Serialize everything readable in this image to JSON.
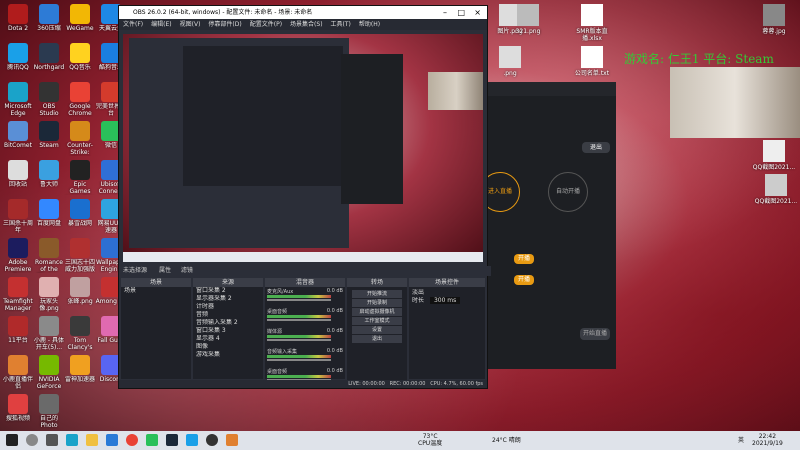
{
  "desktop": {
    "left_icons": [
      {
        "label": "Dota 2",
        "color": "#b01c1c"
      },
      {
        "label": "360压缩",
        "color": "#2d7bd6"
      },
      {
        "label": "WeGame",
        "color": "#f2b705"
      },
      {
        "label": "天翼云盘",
        "color": "#1e88e5"
      },
      {
        "label": "腾讯QQ",
        "color": "#1aa0e8"
      },
      {
        "label": "Northgard",
        "color": "#2b3a50"
      },
      {
        "label": "QQ音乐",
        "color": "#ffd21f"
      },
      {
        "label": "酷狗音乐",
        "color": "#1a7ee0"
      },
      {
        "label": "Microsoft Edge",
        "color": "#1aa3c9"
      },
      {
        "label": "OBS Studio",
        "color": "#333333"
      },
      {
        "label": "Google Chrome",
        "color": "#e94235"
      },
      {
        "label": "完美世界平台",
        "color": "#d43b2c"
      },
      {
        "label": "BitComet",
        "color": "#5a8fd6"
      },
      {
        "label": "Steam",
        "color": "#1b2838"
      },
      {
        "label": "Counter-Strike: Global Off...",
        "color": "#d58a1a"
      },
      {
        "label": "微信",
        "color": "#2ac05a"
      },
      {
        "label": "回收站",
        "color": "#dddddd"
      },
      {
        "label": "鲁大师",
        "color": "#3aa0e0"
      },
      {
        "label": "Epic Games Launcher",
        "color": "#222222"
      },
      {
        "label": "Ubisoft Connect",
        "color": "#2f6fd6"
      },
      {
        "label": "三国杀十周年",
        "color": "#a52a2a"
      },
      {
        "label": "百度网盘",
        "color": "#3388ff"
      },
      {
        "label": "暴雪战网",
        "color": "#1a6fcf"
      },
      {
        "label": "网易UU加速器",
        "color": "#2ea4e0"
      },
      {
        "label": "Adobe Premiere Pro",
        "color": "#1c1c5e"
      },
      {
        "label": "Romance of the Three ...",
        "color": "#8a5a2a"
      },
      {
        "label": "三国志十四威力加强版",
        "color": "#b03030"
      },
      {
        "label": "Wallpaper Engine",
        "color": "#2d6fd2"
      },
      {
        "label": "Teamfight Manager",
        "color": "#c43030"
      },
      {
        "label": "玩家头像.png",
        "color": "#e0b0b0"
      },
      {
        "label": "张峰.png",
        "color": "#c0a0a0"
      },
      {
        "label": "Among Us",
        "color": "#c43030"
      },
      {
        "label": "11平台",
        "color": "#b02a2a"
      },
      {
        "label": "小鹿 - 具体开车(5)...",
        "color": "#8a8a8a"
      },
      {
        "label": "Tom Clancy's R...",
        "color": "#3a3a3a"
      },
      {
        "label": "Fall Guys",
        "color": "#e06ab0"
      },
      {
        "label": "小鹿直播伴侣",
        "color": "#e08030"
      },
      {
        "label": "NVIDIA GeForce Exper...",
        "color": "#76b900"
      },
      {
        "label": "雷神加速器",
        "color": "#f0a020"
      },
      {
        "label": "Discord",
        "color": "#5865f2"
      },
      {
        "label": "搜狐视频",
        "color": "#e04040"
      },
      {
        "label": "自己的Photo",
        "color": "#6a6a6a"
      }
    ],
    "right_icons": [
      {
        "label": "图片.png",
        "color": "#ddd"
      },
      {
        "label": "321.png",
        "color": "#bbb"
      },
      {
        "label": "SMR版本直播.xlsx",
        "color": "#ffffff"
      },
      {
        "label": "蓉蓉.jpg",
        "color": "#888"
      },
      {
        "label": "QQ截图2021...",
        "color": "#eee"
      },
      {
        "label": "QQ截图2021...",
        "color": "#ccc"
      },
      {
        "label": ".png",
        "color": "#ddd"
      },
      {
        "label": "公司名单.txt",
        "color": "#fff"
      }
    ]
  },
  "overlay": {
    "text": "游戏名: 仁王1 平台: Steam"
  },
  "obs": {
    "title": "OBS 26.0.2 (64-bit, windows) - 配置文件: 未命名 - 场景: 未命名",
    "menu": [
      "文件(F)",
      "编辑(E)",
      "视图(V)",
      "停靠部件(D)",
      "配置文件(P)",
      "场景集合(S)",
      "工具(T)",
      "帮助(H)"
    ],
    "scene_label": "未选择源",
    "tabs": {
      "properties": "属性",
      "filters": "滤镜"
    },
    "docks": [
      "场景",
      "来源",
      "混音器",
      "转场",
      "场景控件"
    ],
    "scenes": [
      "场景"
    ],
    "sources": [
      "窗口采集 2",
      "显示器采集 2",
      "计时器",
      "音频",
      "音频输入采集 2",
      "窗口采集 3",
      "显示器 4",
      "图像",
      "游戏采集"
    ],
    "mixer": [
      {
        "name": "麦克风/Aux",
        "db": "0.0 dB"
      },
      {
        "name": "桌面音频",
        "db": "0.0 dB"
      },
      {
        "name": "媒体源",
        "db": "0.0 dB"
      },
      {
        "name": "音频输入采集",
        "db": "0.0 dB"
      },
      {
        "name": "桌面音频",
        "db": "0.0 dB"
      }
    ],
    "transition": {
      "type": "淡出",
      "duration_label": "时长",
      "duration": "300 ms"
    },
    "controls": [
      "开始推流",
      "开始录制",
      "启动虚拟摄像机",
      "工作室模式",
      "设置",
      "退出"
    ],
    "status": {
      "live": "LIVE: 00:00:00",
      "rec": "REC: 00:00:00",
      "cpu": "CPU: 4.7%, 60.00 fps"
    }
  },
  "live_app": {
    "top_button": "退出",
    "step3": "3",
    "step4": "4",
    "btn_a": "开播",
    "btn_b": "开播",
    "start": "开始直播",
    "circle_left": "进入直播",
    "circle_right": "自动开播"
  },
  "taskbar": {
    "weather_temp": "73°C",
    "weather_label": "CPU温度",
    "temp": "24°C",
    "weather": "晴朗",
    "time": "22:42",
    "date": "2021/9/19",
    "lang": "英"
  }
}
